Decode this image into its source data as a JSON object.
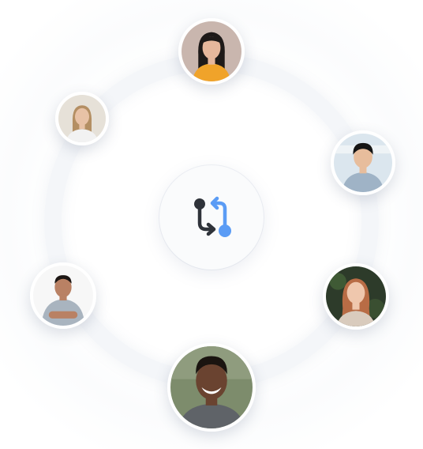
{
  "hub": {
    "icon": "git-pull-request-icon",
    "colors": {
      "dark": "#2f333a",
      "accent": "#5b9cf5"
    }
  },
  "avatars": [
    {
      "id": "top",
      "icon": "person-avatar-icon",
      "bg": "#c9b6ae",
      "skin": "#e6b79c",
      "hair": "#1e1a19",
      "shirt": "#f0a32a"
    },
    {
      "id": "upper-left",
      "icon": "person-avatar-icon",
      "bg": "#e6e1d8",
      "skin": "#e8c2a6",
      "hair": "#b48f63",
      "shirt": "#f2f2f2"
    },
    {
      "id": "upper-right",
      "icon": "person-avatar-icon",
      "bg": "#dbe6ee",
      "skin": "#e7bd9c",
      "hair": "#151515",
      "shirt": "#9fb3c6"
    },
    {
      "id": "lower-left",
      "icon": "person-avatar-icon",
      "bg": "#f7f7f7",
      "skin": "#b98164",
      "hair": "#1d1714",
      "shirt": "#a9b4bf"
    },
    {
      "id": "lower-right",
      "icon": "person-avatar-icon",
      "bg": "#2d3b2a",
      "skin": "#efc7ad",
      "hair": "#b86c45",
      "shirt": "#d9cbbd"
    },
    {
      "id": "bottom",
      "icon": "person-avatar-icon",
      "bg": "#7d8c6c",
      "skin": "#6a4330",
      "hair": "#1a1410",
      "shirt": "#5f6368"
    }
  ]
}
